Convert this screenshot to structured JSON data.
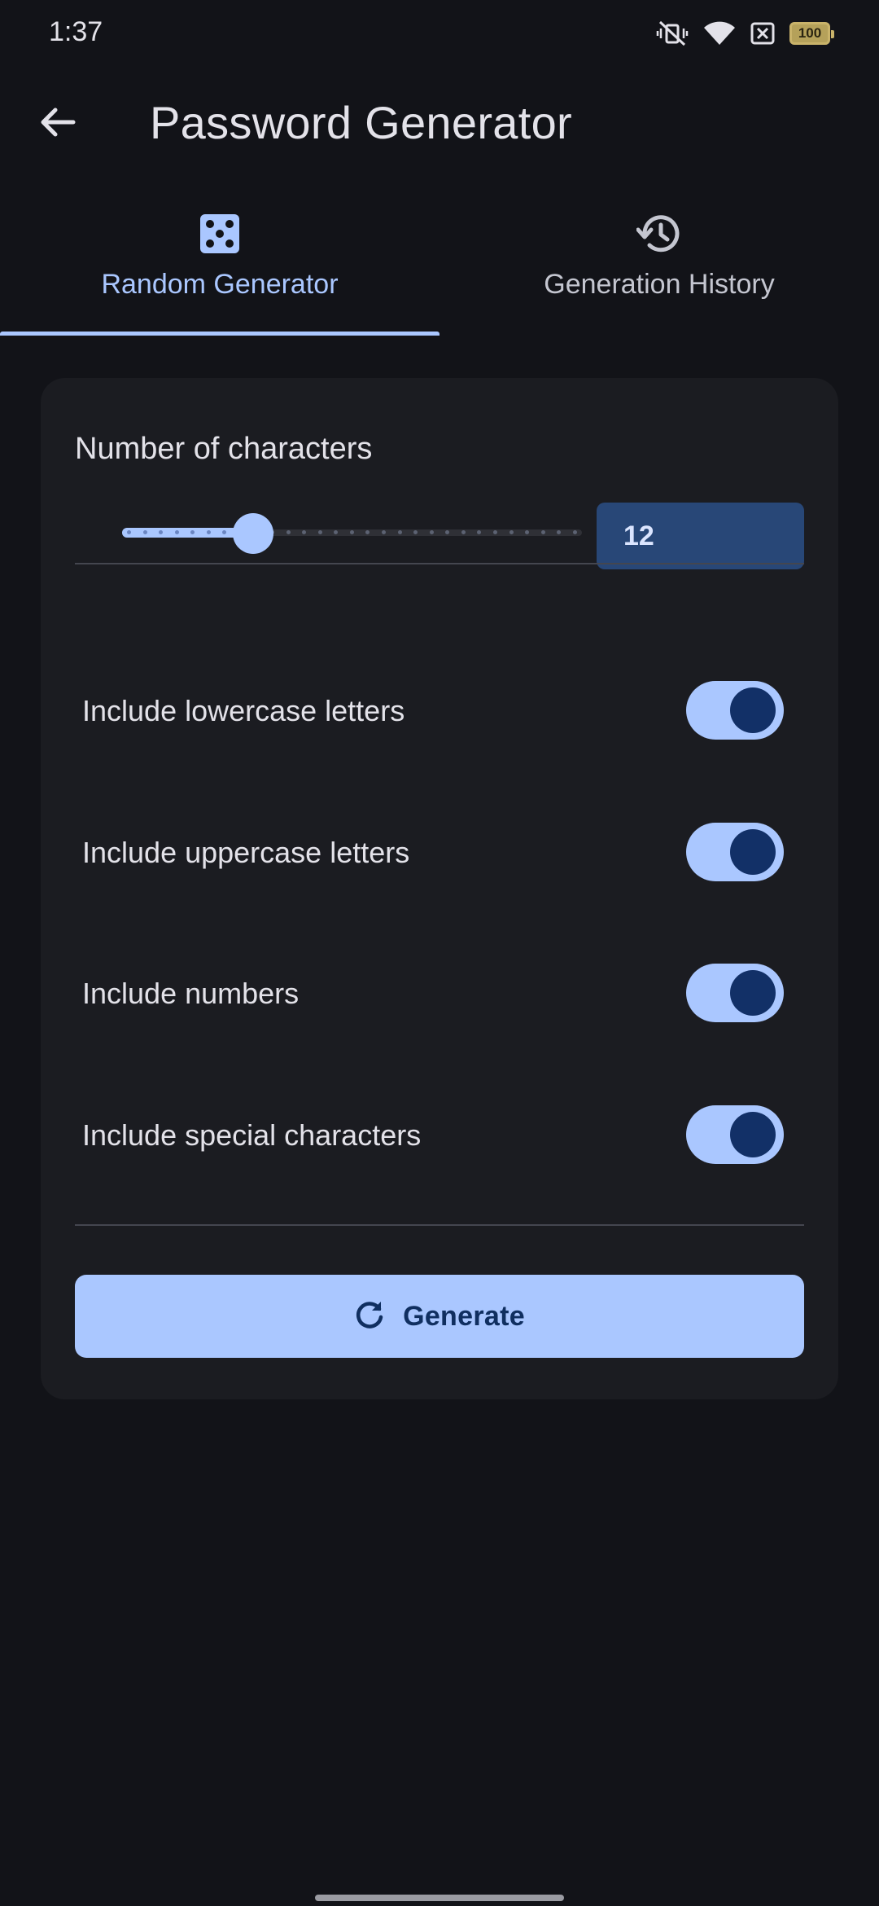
{
  "status_bar": {
    "time": "1:37",
    "battery_level": "100",
    "icons": [
      "vibrate-off-icon",
      "wifi-icon",
      "no-sim-icon",
      "battery-icon"
    ]
  },
  "app_bar": {
    "title": "Password Generator",
    "back_icon": "arrow-back-icon"
  },
  "tabs": [
    {
      "label": "Random Generator",
      "icon": "dice-icon",
      "selected": true
    },
    {
      "label": "Generation History",
      "icon": "history-icon",
      "selected": false
    }
  ],
  "generator": {
    "length_title": "Number of characters",
    "length_value": "12",
    "slider": {
      "value": 12,
      "min": 4,
      "max": 32,
      "fraction": 0.294
    },
    "options": [
      {
        "label": "Include lowercase letters",
        "enabled": true
      },
      {
        "label": "Include uppercase letters",
        "enabled": true
      },
      {
        "label": "Include numbers",
        "enabled": true
      },
      {
        "label": "Include special characters",
        "enabled": true
      }
    ],
    "generate_label": "Generate",
    "generate_icon": "refresh-icon"
  },
  "colors": {
    "background": "#121318",
    "card": "#1b1c21",
    "accent": "#aac7ff",
    "on_accent": "#102f60",
    "field": "#284777",
    "text": "#e3e2e9"
  }
}
